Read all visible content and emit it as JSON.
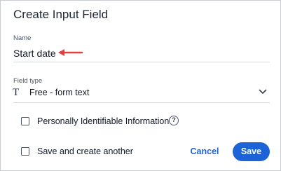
{
  "dialog": {
    "title": "Create Input Field",
    "name_field": {
      "label": "Name",
      "value": "Start date",
      "annotation": "red-arrow-icon"
    },
    "type_field": {
      "label": "Field type",
      "icon": "text-type-icon",
      "icon_glyph": "T",
      "value": "Free - form text"
    },
    "pii_checkbox": {
      "label": "Personally Identifiable Information",
      "checked": false,
      "help_glyph": "?"
    },
    "save_another_checkbox": {
      "label": "Save and create another",
      "checked": false
    },
    "buttons": {
      "cancel": "Cancel",
      "save": "Save"
    },
    "colors": {
      "accent": "#1d63d8",
      "annotation_arrow": "#e0423f"
    }
  }
}
